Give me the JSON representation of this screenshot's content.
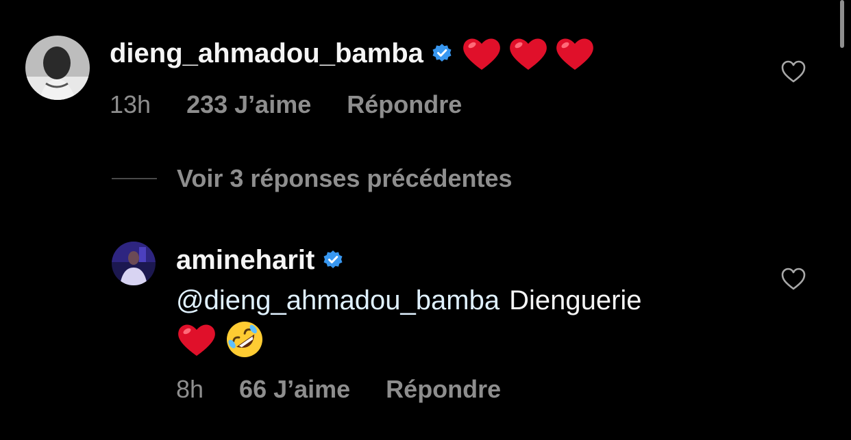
{
  "comments": [
    {
      "username": "dieng_ahmadou_bamba",
      "verified": true,
      "text_emojis": [
        "heart",
        "heart",
        "heart"
      ],
      "time": "13h",
      "likes": "233 J’aime",
      "reply_label": "Répondre"
    }
  ],
  "view_replies_label": "Voir 3 réponses précédentes",
  "reply": {
    "username": "amineharit",
    "verified": true,
    "mention": "@dieng_ahmadou_bamba",
    "text": "Dienguerie",
    "emojis": [
      "heart",
      "rolling-on-the-floor-laughing"
    ],
    "time": "8h",
    "likes": "66 J’aime",
    "reply_label": "Répondre"
  },
  "colors": {
    "background": "#000000",
    "primary_text": "#f5f5f5",
    "secondary_text": "#8e8e8e",
    "mention": "#e0f1ff",
    "verified_badge": "#3897f0",
    "heart": "#e0102a"
  },
  "icons": [
    "verified-badge-icon",
    "heart-outline-icon",
    "red-heart-emoji",
    "rofl-emoji"
  ]
}
